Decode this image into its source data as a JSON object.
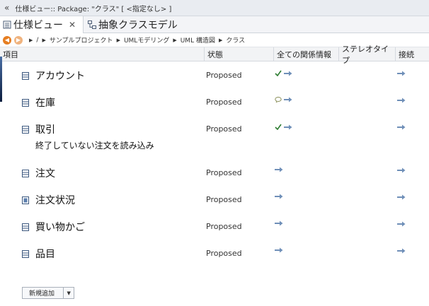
{
  "window": {
    "title": "仕様ビュー:: Package: \"クラス\" [ <指定なし> ]"
  },
  "tabs": [
    {
      "label": "仕様ビュー",
      "active": true
    },
    {
      "label": "抽象クラスモデル",
      "active": false
    }
  ],
  "breadcrumb": [
    "/",
    "サンプルプロジェクト",
    "UMLモデリング",
    "UML 構造図",
    "クラス"
  ],
  "columns": [
    "項目",
    "状態",
    "全ての関係情報",
    "ステレオタイプ",
    "接続"
  ],
  "rows": [
    {
      "name": "アカウント",
      "status": "Proposed",
      "relation_icons": [
        "checkmark-icon",
        "arrow-right-icon"
      ],
      "connector": "arrow-right-icon"
    },
    {
      "name": "在庫",
      "status": "Proposed",
      "relation_icons": [
        "comment-icon",
        "arrow-right-icon"
      ],
      "connector": "arrow-right-icon"
    },
    {
      "name": "取引",
      "note": "終了していない注文を読み込み",
      "status": "Proposed",
      "relation_icons": [
        "checkmark-icon",
        "arrow-right-icon"
      ],
      "connector": "arrow-right-icon",
      "selected": true
    },
    {
      "name": "注文",
      "status": "Proposed",
      "relation_icons": [
        "arrow-right-icon"
      ],
      "connector": "arrow-right-icon"
    },
    {
      "name": "注文状況",
      "status": "Proposed",
      "relation_icons": [
        "arrow-right-icon"
      ],
      "connector": "arrow-right-icon"
    },
    {
      "name": "買い物かご",
      "status": "Proposed",
      "relation_icons": [
        "arrow-right-icon"
      ],
      "connector": "arrow-right-icon"
    },
    {
      "name": "品目",
      "status": "Proposed",
      "relation_icons": [
        "arrow-right-icon"
      ],
      "connector": "arrow-right-icon"
    }
  ],
  "new_button": {
    "label": "新規追加"
  },
  "colors": {
    "accent": "#e67e22",
    "selection": "#0b1c3d",
    "arrow": "#6f8fb8",
    "check": "#2e7d32"
  }
}
